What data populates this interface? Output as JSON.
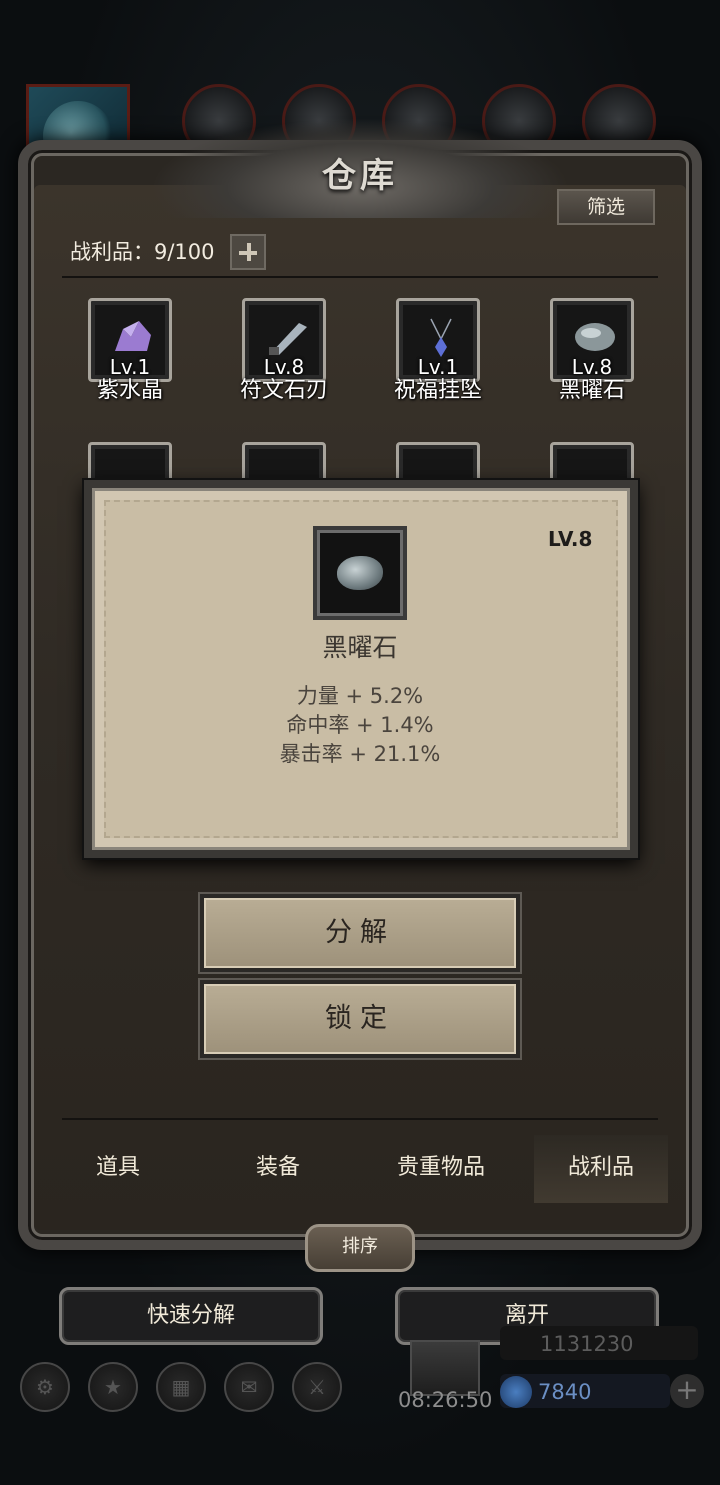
{
  "window": {
    "title": "仓库",
    "filter_label": "筛选"
  },
  "inventory": {
    "capacity_label": "战利品：9/100",
    "items": [
      {
        "name": "紫水晶",
        "level": "Lv.1",
        "icon": "amethyst-icon",
        "color": "#9b7bd1"
      },
      {
        "name": "符文石刃",
        "level": "Lv.8",
        "icon": "rune-blade-icon",
        "color": "#a9b4bd"
      },
      {
        "name": "祝福挂坠",
        "level": "Lv.1",
        "icon": "pendant-icon",
        "color": "#5d6fd6"
      },
      {
        "name": "黑曜石",
        "level": "Lv.8",
        "icon": "obsidian-icon",
        "color": "#8b979a"
      }
    ],
    "second_row_icons": [
      "teal-gem-icon",
      "teal-gem-icon",
      "gray-stone-icon",
      "gray-stone-icon"
    ]
  },
  "detail": {
    "level": "LV.8",
    "name": "黑曜石",
    "stats": [
      "力量 + 5.2%",
      "命中率 + 1.4%",
      "暴击率 + 21.1%"
    ],
    "decompose_label": "分解",
    "lock_label": "锁定"
  },
  "tabs": [
    {
      "label": "道具",
      "active": false
    },
    {
      "label": "装备",
      "active": false
    },
    {
      "label": "贵重物品",
      "active": false
    },
    {
      "label": "战利品",
      "active": true
    }
  ],
  "sort_label": "排序",
  "bottom": {
    "quick_decompose_label": "快速分解",
    "leave_label": "离开"
  },
  "hud": {
    "timer": "08:26:50",
    "gold": "1131230",
    "gems": "7840"
  },
  "colors": {
    "panel_bg": "#2b2722",
    "popup_bg": "#d2c7b2",
    "button_bg": "#b9ad95",
    "frame": "#4a4744"
  }
}
